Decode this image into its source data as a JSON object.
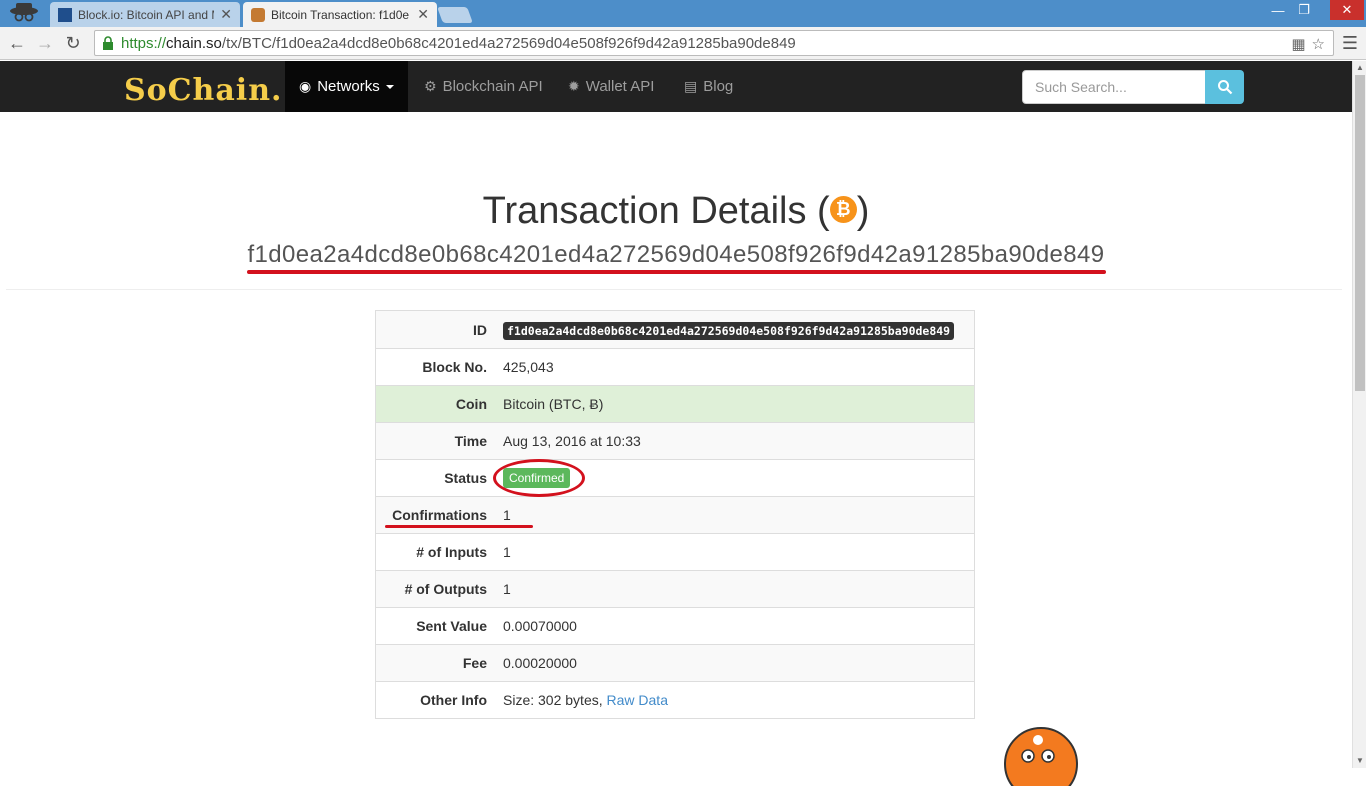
{
  "browser": {
    "tabs": [
      {
        "title": "Block.io: Bitcoin API and M",
        "active": false
      },
      {
        "title": "Bitcoin Transaction: f1d0e",
        "active": true
      }
    ],
    "url_https": "https://",
    "url_host": "chain.so",
    "url_path": "/tx/BTC/f1d0ea2a4dcd8e0b68c4201ed4a272569d04e508f926f9d42a91285ba90de849"
  },
  "nav": {
    "logo": "SoChain.",
    "items": [
      {
        "label": "Networks"
      },
      {
        "label": "Blockchain API"
      },
      {
        "label": "Wallet API"
      },
      {
        "label": "Blog"
      }
    ],
    "search_placeholder": "Such Search..."
  },
  "main": {
    "title": "Transaction Details (",
    "title_close": ")",
    "coin_symbol": "₿",
    "hash": "f1d0ea2a4dcd8e0b68c4201ed4a272569d04e508f926f9d42a91285ba90de849"
  },
  "details": {
    "rows": [
      {
        "label": "ID",
        "value": "f1d0ea2a4dcd8e0b68c4201ed4a272569d04e508f926f9d42a91285ba90de849"
      },
      {
        "label": "Block No.",
        "value": "425,043"
      },
      {
        "label": "Coin",
        "value": "Bitcoin (BTC, Ƀ)"
      },
      {
        "label": "Time",
        "value": "Aug 13, 2016 at 10:33"
      },
      {
        "label": "Status",
        "value": "Confirmed"
      },
      {
        "label": "Confirmations",
        "value": "1"
      },
      {
        "label": "# of Inputs",
        "value": "1"
      },
      {
        "label": "# of Outputs",
        "value": "1"
      },
      {
        "label": "Sent Value",
        "value": "0.00070000"
      },
      {
        "label": "Fee",
        "value": "0.00020000"
      },
      {
        "label": "Other Info",
        "value": "Size: 302 bytes, ",
        "link": "Raw Data"
      }
    ]
  },
  "colors": {
    "navbar": "#222222",
    "accent_link": "#428bca",
    "success_badge": "#5cb85c",
    "annotation_red": "#d3111d",
    "bitcoin_orange": "#f7931a"
  }
}
